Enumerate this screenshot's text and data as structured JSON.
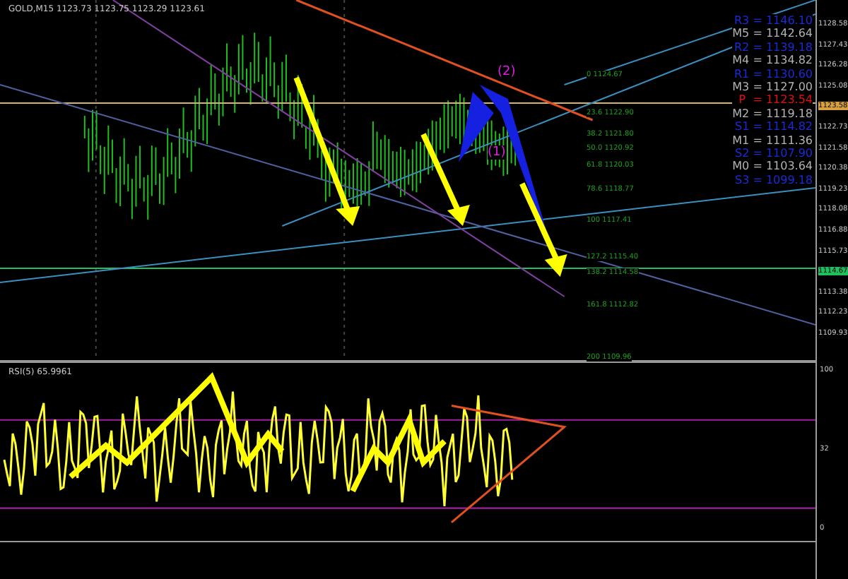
{
  "chart_title": "GOLD,M15  1123.73 1123.75 1123.29 1123.61",
  "pivots": [
    {
      "label": "R3 = 1146.10",
      "color": "#1a2bd8"
    },
    {
      "label": "M5 = 1142.64",
      "color": "#b4b4b4"
    },
    {
      "label": "R2 = 1139.18",
      "color": "#1a2bd8"
    },
    {
      "label": "M4 = 1134.82",
      "color": "#b4b4b4"
    },
    {
      "label": "R1 = 1130.60",
      "color": "#1a2bd8"
    },
    {
      "label": "M3 = 1127.00",
      "color": "#b4b4b4"
    },
    {
      "label": "P  = 1123.54",
      "color": "#e01010"
    },
    {
      "label": "M2 = 1119.18",
      "color": "#b4b4b4"
    },
    {
      "label": "S1 = 1114.82",
      "color": "#1a2bd8"
    },
    {
      "label": "M1 = 1111.36",
      "color": "#b4b4b4"
    },
    {
      "label": "S2 = 1107.90",
      "color": "#1a2bd8"
    },
    {
      "label": "M0 = 1103.64",
      "color": "#b4b4b4"
    },
    {
      "label": "S3 = 1099.18",
      "color": "#1a2bd8"
    }
  ],
  "price_axis": [
    {
      "label": "1128.58",
      "kind": "plain"
    },
    {
      "label": "1127.43",
      "kind": "plain"
    },
    {
      "label": "1126.28",
      "kind": "plain"
    },
    {
      "label": "1125.08",
      "kind": "plain"
    },
    {
      "label": "1123.58",
      "kind": "current"
    },
    {
      "label": "1122.73",
      "kind": "plain"
    },
    {
      "label": "1121.58",
      "kind": "plain"
    },
    {
      "label": "1120.38",
      "kind": "plain"
    },
    {
      "label": "1119.23",
      "kind": "plain"
    },
    {
      "label": "1118.08",
      "kind": "plain"
    },
    {
      "label": "1116.88",
      "kind": "plain"
    },
    {
      "label": "1115.73",
      "kind": "plain"
    },
    {
      "label": "1114.67",
      "kind": "marker"
    },
    {
      "label": "1113.38",
      "kind": "plain"
    },
    {
      "label": "1112.23",
      "kind": "plain"
    },
    {
      "label": "1109.93",
      "kind": "plain"
    }
  ],
  "fib_levels": [
    "0 1124.67",
    "23.6 1122.90",
    "38.2 1121.80",
    "50.0 1120.92",
    "61.8 1120.03",
    "78.6 1118.77",
    "100 1117.41",
    "127.2 1115.40",
    "138.2 1114.58",
    "161.8 1112.82",
    "200 1109.96"
  ],
  "wave_marks": [
    "(2)",
    "(1)"
  ],
  "rsi": {
    "title": "RSI(5) 65.9961",
    "axis": [
      "100",
      "32",
      "0"
    ]
  }
}
